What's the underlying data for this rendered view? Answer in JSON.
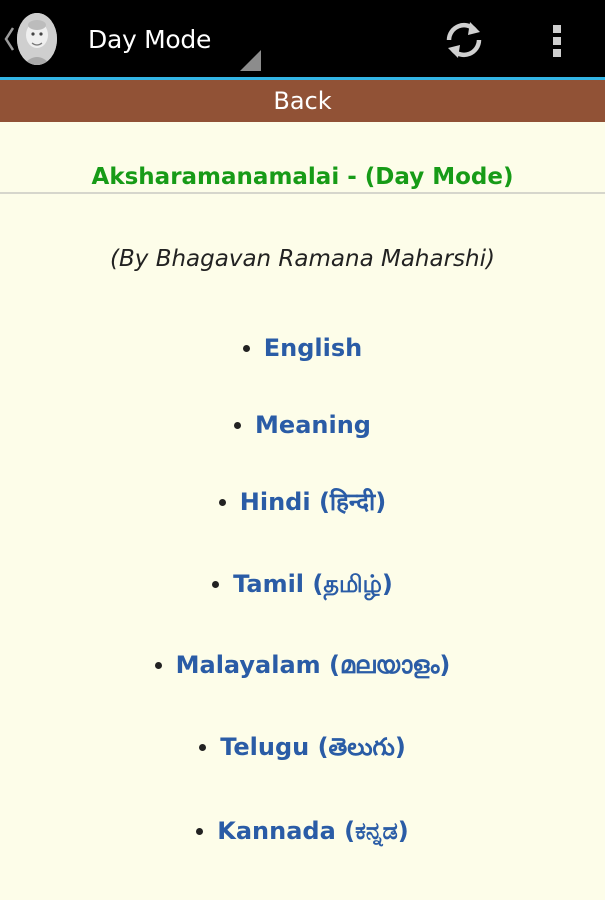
{
  "actionbar": {
    "title": "Day Mode",
    "icons": {
      "up": "chevron-left-icon",
      "avatar": "ramana-maharshi-portrait",
      "refresh": "refresh-icon",
      "overflow": "overflow-menu-icon"
    },
    "colors": {
      "background": "#000000",
      "accent_line": "#33b5e5",
      "icon": "#d0d0d0"
    }
  },
  "back_bar": {
    "label": "Back",
    "color": "#915236"
  },
  "content": {
    "title": "Aksharamanamalai - (Day Mode)",
    "title_color": "#179b17",
    "author": "(By Bhagavan Ramana Maharshi)",
    "link_color": "#2a5ca6",
    "background": "#fdfde9",
    "languages": [
      {
        "label": "English"
      },
      {
        "label": "Meaning"
      },
      {
        "label": "Hindi (हिन्दी)"
      },
      {
        "label": "Tamil (தமிழ்)"
      },
      {
        "label": "Malayalam (മലയാളം)"
      },
      {
        "label": "Telugu (తెలుగు)"
      },
      {
        "label": "Kannada (ಕನ್ನಡ)"
      }
    ]
  }
}
